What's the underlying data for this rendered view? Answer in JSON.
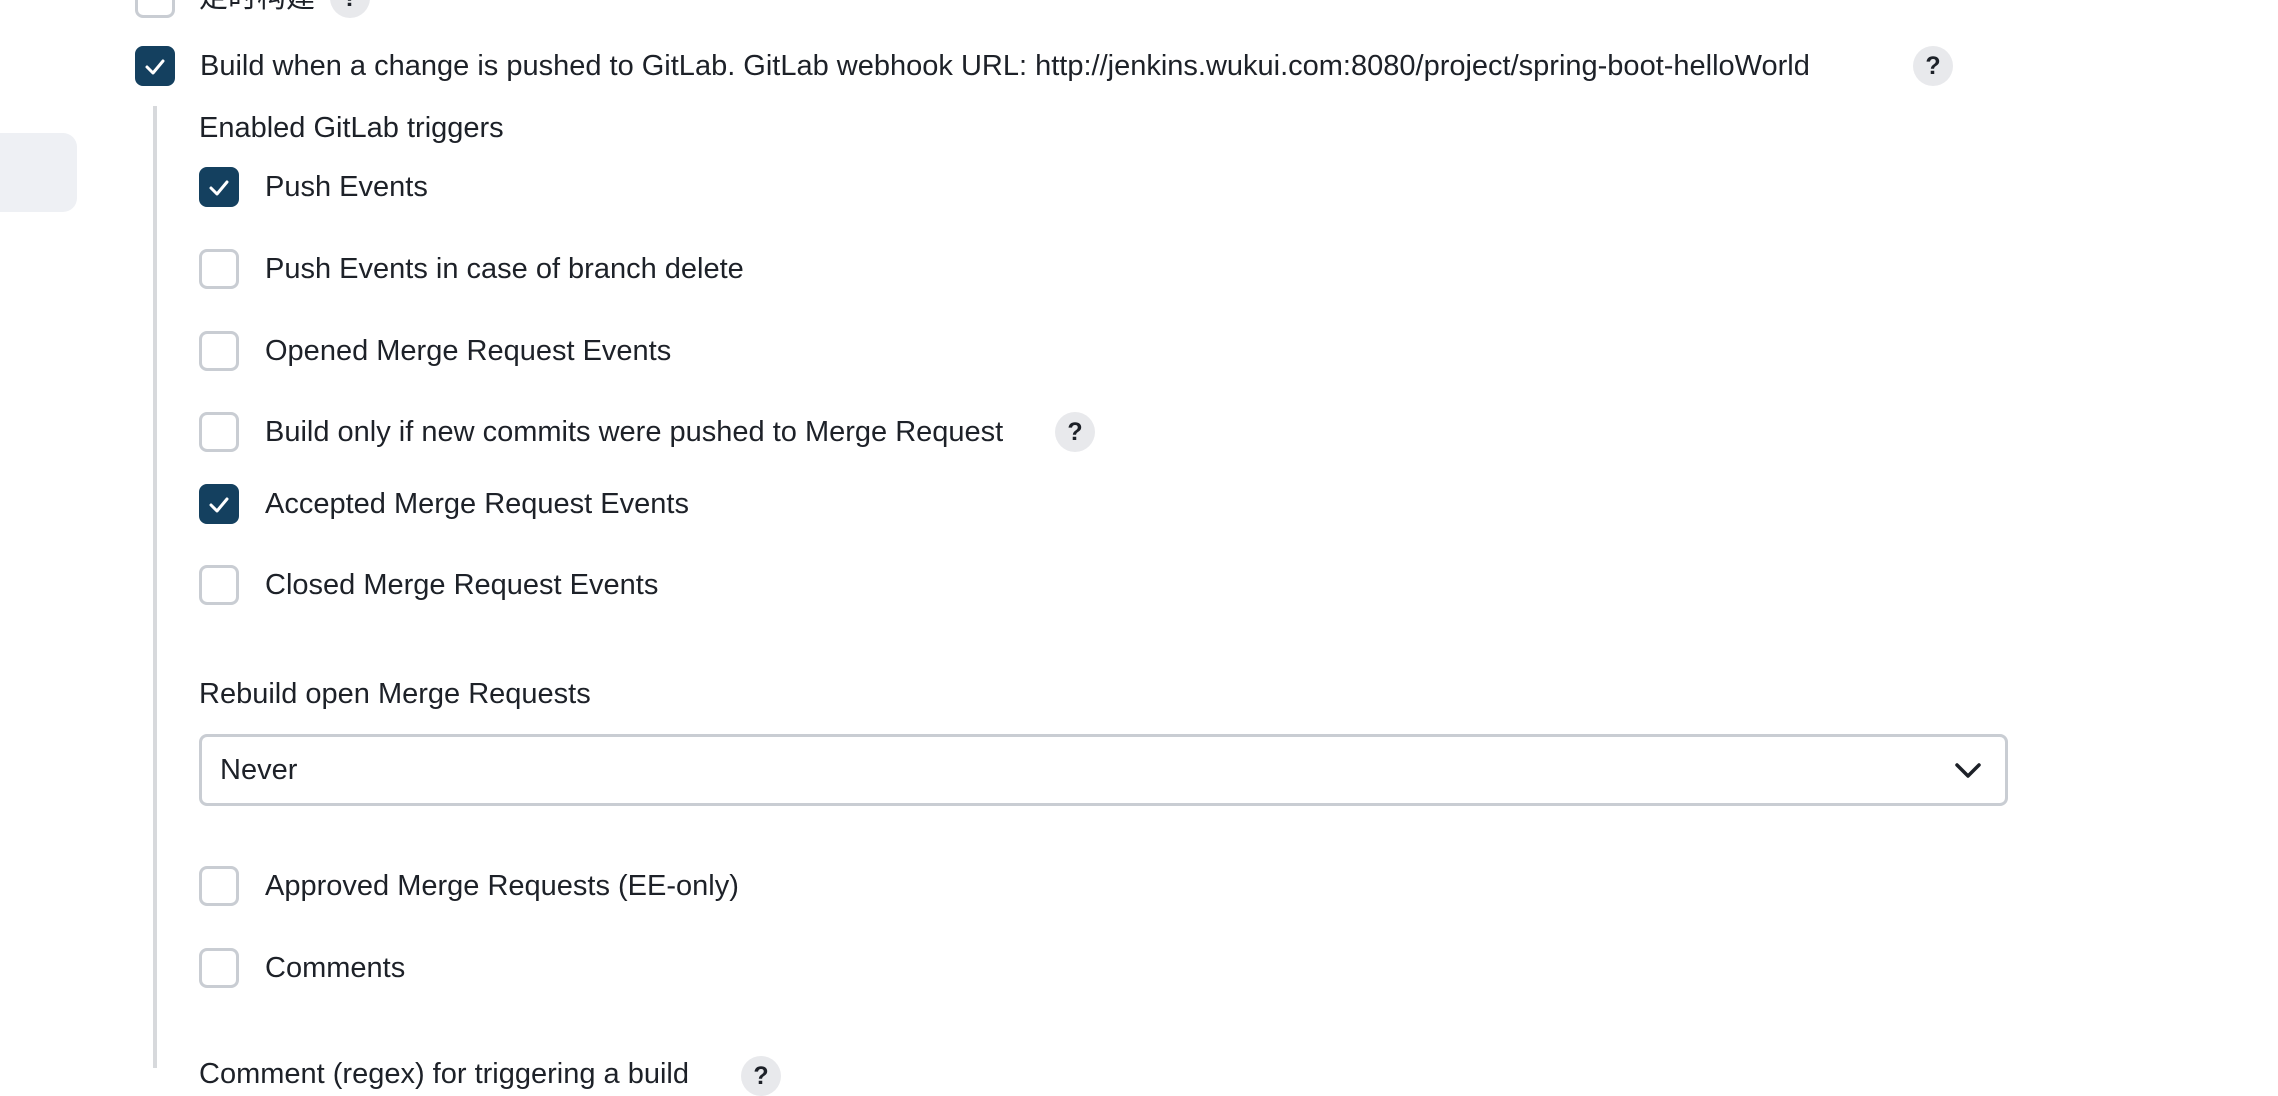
{
  "top_partial": {
    "label": "定时构建",
    "help": "?"
  },
  "gitlab_trigger": {
    "label": "Build when a change is pushed to GitLab. GitLab webhook URL: http://jenkins.wukui.com:8080/project/spring-boot-helloWorld",
    "checked": true,
    "help": "?"
  },
  "enabled_triggers_heading": "Enabled GitLab triggers",
  "triggers": [
    {
      "label": "Push Events",
      "checked": true
    },
    {
      "label": "Push Events in case of branch delete",
      "checked": false
    },
    {
      "label": "Opened Merge Request Events",
      "checked": false
    },
    {
      "label": "Build only if new commits were pushed to Merge Request",
      "checked": false,
      "help": "?"
    },
    {
      "label": "Accepted Merge Request Events",
      "checked": true
    },
    {
      "label": "Closed Merge Request Events",
      "checked": false
    }
  ],
  "rebuild": {
    "label": "Rebuild open Merge Requests",
    "value": "Never"
  },
  "extra_triggers": [
    {
      "label": "Approved Merge Requests (EE-only)",
      "checked": false
    },
    {
      "label": "Comments",
      "checked": false
    }
  ],
  "bottom_partial": {
    "label": "Comment (regex) for triggering a build",
    "help": "?"
  },
  "colors": {
    "checkbox_checked": "#14405f",
    "checkbox_border": "#c9cdd3",
    "help_bg": "#e8e9ec"
  }
}
